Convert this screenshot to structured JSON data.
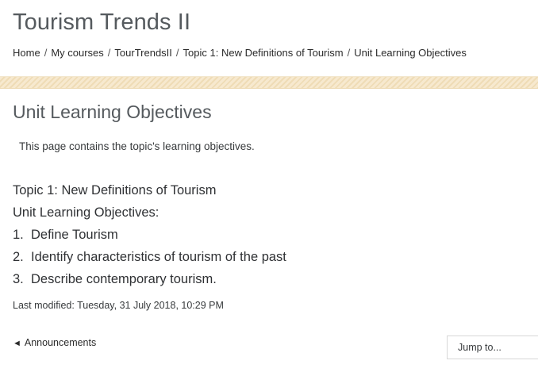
{
  "header": {
    "course_title": "Tourism Trends II"
  },
  "breadcrumb": {
    "items": [
      "Home",
      "My courses",
      "TourTrendsII",
      "Topic 1: New Definitions of Tourism",
      "Unit Learning Objectives"
    ],
    "separator": "/"
  },
  "page": {
    "heading": "Unit Learning Objectives",
    "intro": "This page contains the topic's learning objectives.",
    "content": {
      "topic": "Topic 1: New Definitions of Tourism",
      "subtitle": "Unit Learning Objectives:",
      "objectives": [
        {
          "num": "1.",
          "text": "Define Tourism"
        },
        {
          "num": "2.",
          "text": "Identify characteristics of tourism of the past"
        },
        {
          "num": "3.",
          "text": "Describe contemporary tourism."
        }
      ]
    },
    "last_modified": "Last modified: Tuesday, 31 July 2018, 10:29 PM"
  },
  "navigation": {
    "prev_icon": "◄",
    "prev_label": "Announcements",
    "jump_label": "Jump to..."
  }
}
